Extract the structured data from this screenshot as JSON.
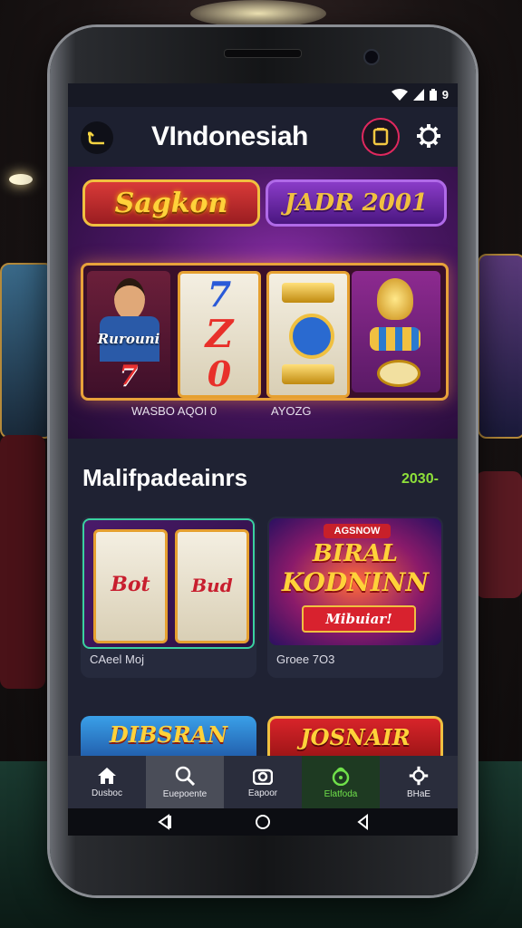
{
  "status_bar": {
    "signal_icon": "wifi-icon",
    "battery_icon": "battery-icon",
    "text": "9"
  },
  "header": {
    "title": "VIndonesiah",
    "back_icon": "back-arrow-icon",
    "wallet_icon": "wallet-icon",
    "settings_icon": "gear-icon"
  },
  "hero": {
    "badge_left": "Sagkon",
    "badge_right": "JADR 2001",
    "reel_person_label": "Rurouni",
    "reel_person_number": "7",
    "reel_a_symbols": [
      "7",
      "Z",
      "0"
    ],
    "caption_left": "WASBO AQOI 0",
    "caption_right": "AYOZG"
  },
  "section": {
    "title": "Malifpadeainrs",
    "count": "2030-"
  },
  "cards": [
    {
      "label": "CAeel Moj",
      "symbols": [
        "Bot",
        "Bud"
      ]
    },
    {
      "label": "Groee 7O3",
      "top": "AGSNOW",
      "line1": "BIRAL",
      "line2": "KODNINN",
      "ribbon": "Mibuiar!"
    }
  ],
  "bottom_cards": [
    {
      "title": "DIBSRAN"
    },
    {
      "title": "JOSNAIR"
    }
  ],
  "nav": [
    {
      "label": "Dusboc",
      "icon": "home-icon"
    },
    {
      "label": "Euepoente",
      "icon": "search-icon"
    },
    {
      "label": "Eapoor",
      "icon": "camera-icon"
    },
    {
      "label": "Elatfoda",
      "icon": "lock-icon"
    },
    {
      "label": "BHaE",
      "icon": "gear-icon"
    }
  ],
  "colors": {
    "accent": "#f0c040",
    "brand": "#8a2fa8",
    "active_green": "#6fe04a"
  }
}
